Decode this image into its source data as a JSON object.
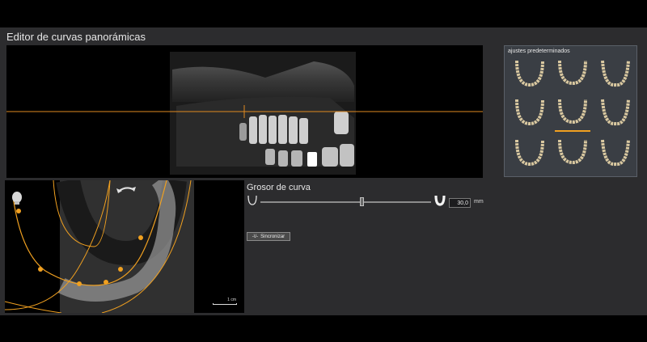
{
  "window": {
    "title": "Editor de curvas panorámicas"
  },
  "presets": {
    "title": "ajustes predeterminados",
    "items": [
      "preset-1",
      "preset-2",
      "preset-3",
      "preset-4",
      "preset-5",
      "preset-6",
      "preset-7",
      "preset-8",
      "preset-9"
    ],
    "selected_index": 4,
    "accent": "#f0a020"
  },
  "curve": {
    "label": "Grosor de curva",
    "value": "30,0",
    "unit": "mm",
    "slider_fraction": 0.58,
    "min_icon": "thin-curve-icon",
    "max_icon": "thick-curve-icon"
  },
  "sync_button": {
    "icon": "sync-icon",
    "icon_glyph": "-\\/-",
    "label": "Sincronizar"
  },
  "axial_view": {
    "scale_label": "1 cm",
    "curve_color": "#f0a020"
  },
  "colors": {
    "background": "#2c2c2e",
    "accent": "#f0a020"
  }
}
